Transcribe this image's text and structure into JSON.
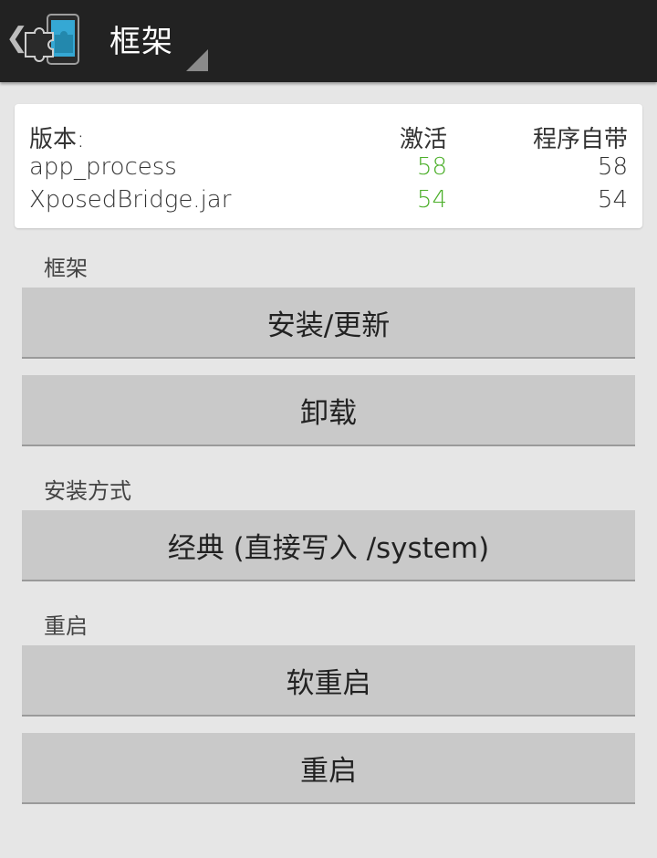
{
  "actionbar": {
    "title": "框架",
    "up_caret": "❮",
    "app_icon": "xposed-puzzle-icon",
    "colors": {
      "background": "#222222",
      "icon_accent": "#35a8d4"
    }
  },
  "versions": {
    "header_label": "版本:",
    "col_active": "激活",
    "col_bundled": "程序自带",
    "rows": [
      {
        "name": "app_process",
        "active": "58",
        "bundled": "58"
      },
      {
        "name": "XposedBridge.jar",
        "active": "54",
        "bundled": "54"
      }
    ],
    "active_color": "#4caf2a"
  },
  "framework": {
    "label": "框架",
    "install_update": "安装/更新",
    "uninstall": "卸载"
  },
  "install_mode": {
    "label": "安装方式",
    "selected": "经典 (直接写入 /system)"
  },
  "reboot": {
    "label": "重启",
    "soft_reboot": "软重启",
    "reboot": "重启"
  }
}
